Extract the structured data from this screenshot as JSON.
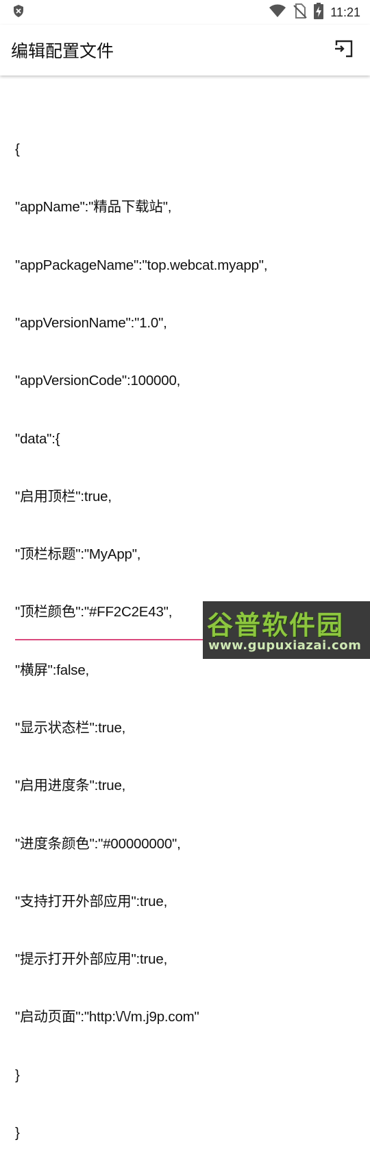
{
  "status_bar": {
    "time": "11:21",
    "icons": [
      "shield-icon",
      "wifi-icon",
      "no-sim-icon",
      "battery-charging-icon"
    ]
  },
  "app_bar": {
    "title": "编辑配置文件",
    "action_icon": "cast-icon"
  },
  "editor": {
    "lines": [
      "{",
      "\"appName\":\"精品下载站\",",
      "\"appPackageName\":\"top.webcat.myapp\",",
      "\"appVersionName\":\"1.0\",",
      "\"appVersionCode\":100000,",
      "\"data\":{",
      "\"启用顶栏\":true,",
      "\"顶栏标题\":\"MyApp\",",
      "\"顶栏颜色\":\"#FF2C2E43\",",
      "\"横屏\":false,",
      "\"显示状态栏\":true,",
      "\"启用进度条\":true,",
      "\"进度条颜色\":\"#00000000\",",
      "\"支持打开外部应用\":true,",
      "\"提示打开外部应用\":true,",
      "\"启动页面\":\"http:\\/\\/m.j9p.com\"",
      "}",
      "}"
    ],
    "underline_color": "#d9497d"
  },
  "watermark": {
    "title": "谷普软件园",
    "url": "www.gupuxiazai.com"
  },
  "colors": {
    "background": "#ffffff",
    "accent": "#d9497d",
    "watermark_green": "#8dc63f"
  }
}
